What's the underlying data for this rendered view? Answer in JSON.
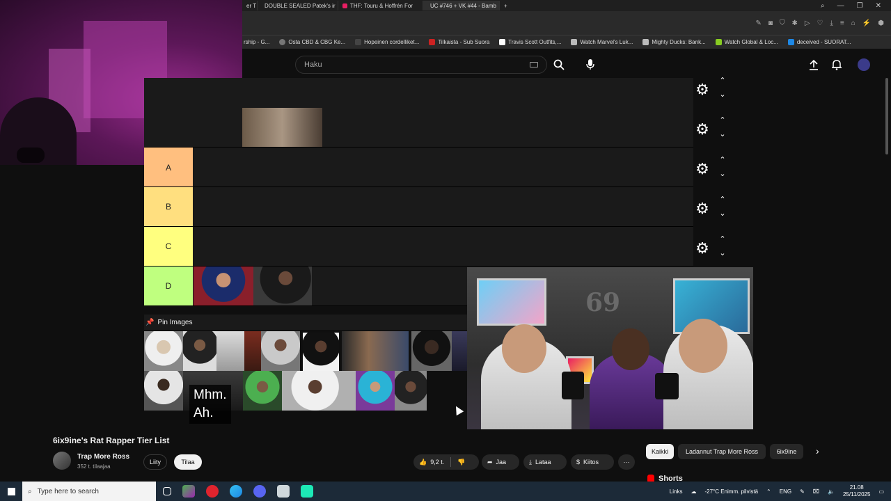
{
  "browser": {
    "tabs": [
      {
        "label": "er T",
        "color": "#888888"
      },
      {
        "label": "DOUBLE SEALED Patek's ir",
        "color": "#ff0000"
      },
      {
        "label": "THF: Touru & Hoffrén For",
        "color": "#e91e63"
      },
      {
        "label": "UC #746 + VK #44 - Bamb",
        "color": "#1db954"
      }
    ],
    "new_tab": "+",
    "bookmarks": [
      {
        "label": "rship - G...",
        "color": "#888888"
      },
      {
        "label": "Osta CBD & CBG Ke...",
        "color": "#777777"
      },
      {
        "label": "Hopeinen cordelliket...",
        "color": "#444444"
      },
      {
        "label": "Tilkaista - Sub Suora",
        "color": "#cc2222"
      },
      {
        "label": "Travis Scott Outfits,...",
        "color": "#ffffff"
      },
      {
        "label": "Watch Marvel's Luk...",
        "color": "#bbbbbb"
      },
      {
        "label": "Mighty Ducks: Bank...",
        "color": "#bbbbbb"
      },
      {
        "label": "Watch Global & Loc...",
        "color": "#88cc22"
      },
      {
        "label": "deceived - SUORAT...",
        "color": "#1e88e5"
      }
    ]
  },
  "youtube": {
    "search_placeholder": "Haku",
    "video_title": "6ix9ine's Rat Rapper Tier List",
    "channel_name": "Trap More Ross",
    "subscribers": "352 t. tilaajaa",
    "join_label": "Liity",
    "subscribe_label": "Tilaa",
    "likes": "9,2 t.",
    "share_label": "Jaa",
    "download_label": "Lataa",
    "thanks_label": "Kiitos",
    "more_label": "···",
    "chips": [
      "Kaikki",
      "Ladannut Trap More Ross",
      "6ix9ine"
    ],
    "shorts_label": "Shorts",
    "subtitle_line1": "Mhm.",
    "subtitle_line2": "Ah."
  },
  "tierlist": {
    "tiers": [
      {
        "label": "",
        "color": "#1a1a1a"
      },
      {
        "label": "",
        "color": "#1a1a1a"
      },
      {
        "label": "A",
        "color": "#ffbf7f"
      },
      {
        "label": "B",
        "color": "#ffdf7f"
      },
      {
        "label": "C",
        "color": "#ffff7f"
      },
      {
        "label": "D",
        "color": "#bfff7f"
      }
    ],
    "pin_label": "Pin Images",
    "pin_icon": "pushpin-icon"
  },
  "taskbar": {
    "search_placeholder": "Type here to search",
    "links": "Links",
    "weather": "-27°C  Enimm. pilvistä",
    "lang": "ENG",
    "time": "21.08",
    "date": "25/11/2025"
  }
}
